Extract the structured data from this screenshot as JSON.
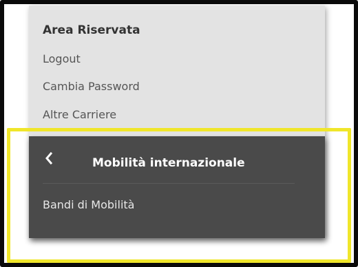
{
  "menu": {
    "title": "Area Riservata",
    "items": [
      {
        "label": "Logout"
      },
      {
        "label": "Cambia Password"
      },
      {
        "label": "Altre Carriere"
      }
    ]
  },
  "submenu": {
    "back_icon": "chevron-left-icon",
    "title": "Mobilità internazionale",
    "items": [
      {
        "label": "Bandi di Mobilità"
      }
    ]
  },
  "colors": {
    "highlight": "#f0e62a",
    "dark_panel": "#4a4a4a",
    "light_panel": "#e3e3e3",
    "frame": "#0a0a0a"
  }
}
